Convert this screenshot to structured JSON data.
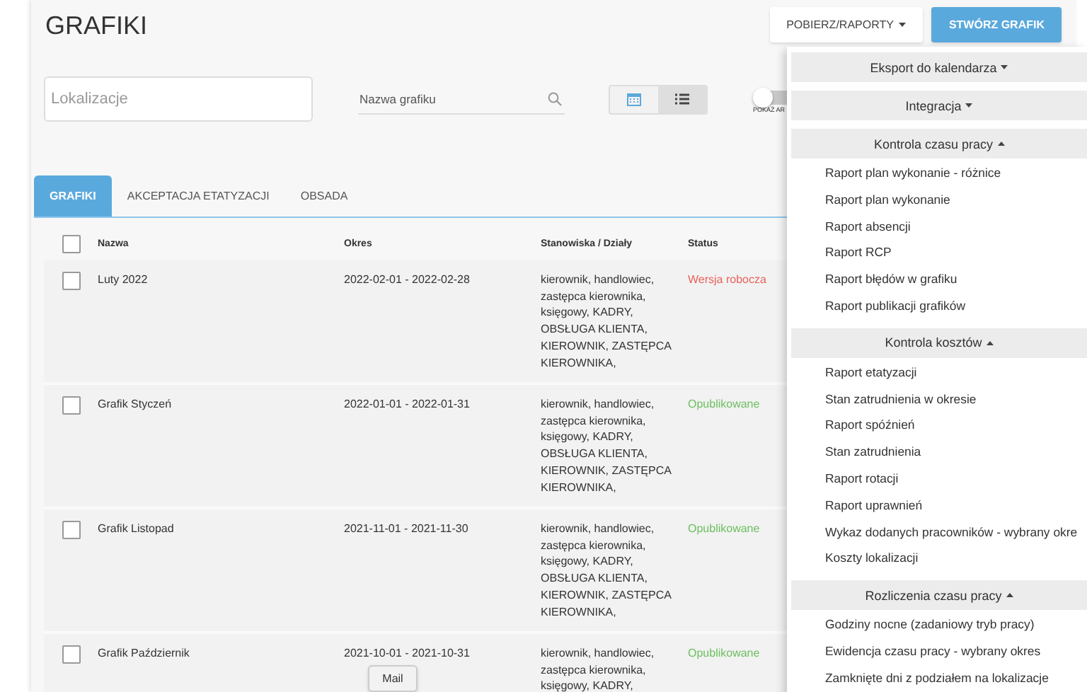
{
  "page_title": "GRAFIKI",
  "header_buttons": [
    {
      "label": "POBIERZ/RAPORTY",
      "kind": "dropdown"
    },
    {
      "label": "STWÓRZ GRAFIK",
      "kind": "primary"
    }
  ],
  "filters": {
    "location": {
      "placeholder": "Lokalizacje"
    },
    "name_search": {
      "placeholder": "Nazwa grafiku"
    },
    "view_toggle": [
      {
        "kind": "calendar",
        "selected": true
      },
      {
        "kind": "list",
        "selected": false
      }
    ],
    "switch": {
      "label": "POKAŻ AR",
      "on": false
    }
  },
  "tabs": [
    {
      "label": "GRAFIKI",
      "selected": true
    },
    {
      "label": "AKCEPTACJA ETATYZACJI",
      "selected": false
    },
    {
      "label": "OBSADA",
      "selected": false
    }
  ],
  "table": {
    "select_all_checked": false,
    "columns": [
      "Nazwa",
      "Okres",
      "Stanowiska / Działy",
      "Status"
    ],
    "rows": [
      {
        "checked": false,
        "name": "Luty 2022",
        "period": "2022-02-01 - 2022-02-28",
        "positions": "kierownik, handlowiec, zastępca kierownika, księgowy, KADRY, OBSŁUGA KLIENTA, KIEROWNIK, ZASTĘPCA KIEROWNIKA,",
        "status": "Wersja robocza",
        "color": "#e8625a"
      },
      {
        "checked": false,
        "name": "Grafik Styczeń",
        "period": "2022-01-01 - 2022-01-31",
        "positions": "kierownik, handlowiec, zastępca kierownika, księgowy, KADRY, OBSŁUGA KLIENTA, KIEROWNIK, ZASTĘPCA KIEROWNIKA,",
        "status": "Opublikowane",
        "color": "#6cbf5f"
      },
      {
        "checked": false,
        "name": "Grafik Listopad",
        "period": "2021-11-01 - 2021-11-30",
        "positions": "kierownik, handlowiec, zastępca kierownika, księgowy, KADRY, OBSŁUGA KLIENTA, KIEROWNIK, ZASTĘPCA KIEROWNIKA,",
        "status": "Opublikowane",
        "color": "#6cbf5f"
      },
      {
        "checked": false,
        "name": "Grafik Październik",
        "period": "2021-10-01 - 2021-10-31",
        "positions": "kierownik, handlowiec, zastępca kierownika, księgowy, KADRY,",
        "status": "Opublikowane",
        "color": "#6cbf5f"
      }
    ]
  },
  "dropdown_menu": [
    {
      "title": "Eksport do kalendarza",
      "expanded": false
    },
    {
      "title": "Integracja",
      "expanded": false
    },
    {
      "title": "Kontrola czasu pracy",
      "expanded": true,
      "items": [
        "Raport plan wykonanie - różnice",
        "Raport plan wykonanie",
        "Raport absencji",
        "Raport RCP",
        "Raport błędów w grafiku",
        "Raport publikacji grafików"
      ]
    },
    {
      "title": "Kontrola kosztów",
      "expanded": true,
      "items": [
        "Raport etatyzacji",
        "Stan zatrudnienia w okresie",
        "Raport spóźnień",
        "Stan zatrudnienia",
        "Raport rotacji",
        "Raport uprawnień",
        "Wykaz dodanych pracowników - wybrany okre",
        "Koszty lokalizacji"
      ]
    },
    {
      "title": "Rozliczenia czasu pracy",
      "expanded": true,
      "items": [
        "Godziny nocne (zadaniowy tryb pracy)",
        "Ewidencja czasu pracy - wybrany okres",
        "Zamknięte dni z podziałem na lokalizacje"
      ]
    }
  ],
  "tooltip": "Mail"
}
